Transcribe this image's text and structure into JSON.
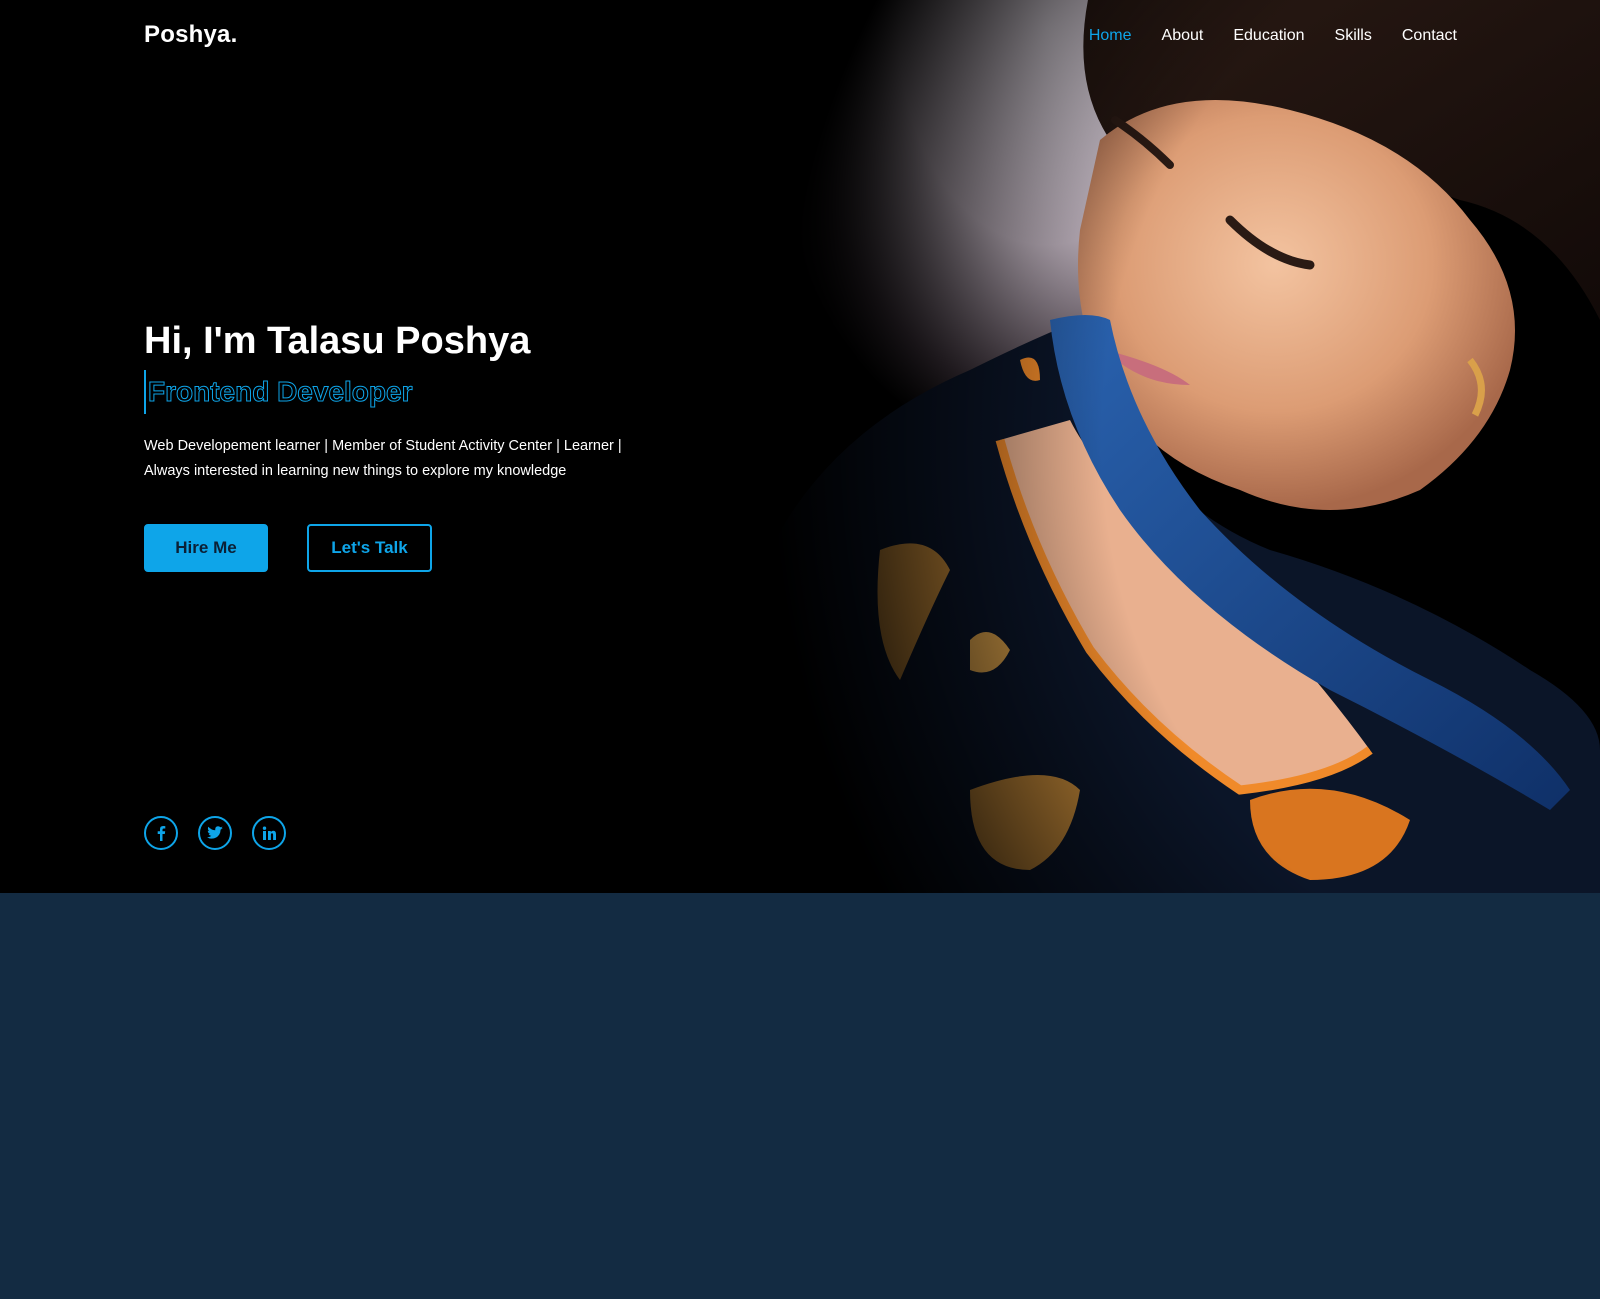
{
  "header": {
    "logo": "Poshya.",
    "nav": [
      {
        "label": "Home",
        "active": true
      },
      {
        "label": "About",
        "active": false
      },
      {
        "label": "Education",
        "active": false
      },
      {
        "label": "Skills",
        "active": false
      },
      {
        "label": "Contact",
        "active": false
      }
    ]
  },
  "hero": {
    "title": "Hi, I'm Talasu Poshya",
    "subtitle": "Frontend Developer",
    "description_line1": "Web Developement learner | Member of Student Activity Center | Learner |",
    "description_line2": "Always interested in learning new things to explore my knowledge",
    "hire_button": "Hire Me",
    "talk_button": "Let's Talk",
    "social_icons": [
      "facebook-icon",
      "twitter-icon",
      "linkedin-icon"
    ]
  },
  "colors": {
    "accent": "#0ea5e9",
    "hero_bg": "#000000",
    "section_bg": "#132b42",
    "text": "#ffffff"
  }
}
